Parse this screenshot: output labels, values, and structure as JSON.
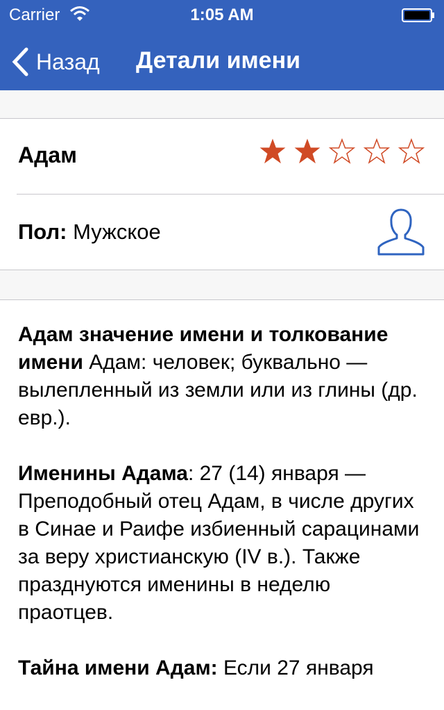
{
  "status_bar": {
    "carrier": "Carrier",
    "time": "1:05 AM"
  },
  "nav": {
    "back_label": "Назад",
    "title": "Детали имени"
  },
  "name": {
    "text": "Адам",
    "rating": 2,
    "max_rating": 5
  },
  "gender": {
    "label": "Пол:",
    "value": "Мужское"
  },
  "paragraphs": [
    {
      "bold": "Адам значение имени и толкование имени",
      "text": " Адам: человек; буквально — вылепленный из земли или из глины (др. евр.)."
    },
    {
      "bold": "Именины Адама",
      "text": ": 27 (14) января — Преподобный отец Адам, в числе других в Синае и Раифе избиенный сарацинами за веру христианскую (IV в.). Также празднуются именины в неделю праотцев."
    },
    {
      "bold": "Тайна имени Адам:",
      "text": " Если 27 января"
    }
  ],
  "colors": {
    "nav_bg": "#3462bd",
    "star_fill": "#d04a25",
    "star_outline": "#d04a25",
    "icon_blue": "#2f64c0"
  },
  "icons": [
    "wifi-icon",
    "battery-icon",
    "back-chevron-icon",
    "star-icon",
    "person-icon"
  ]
}
